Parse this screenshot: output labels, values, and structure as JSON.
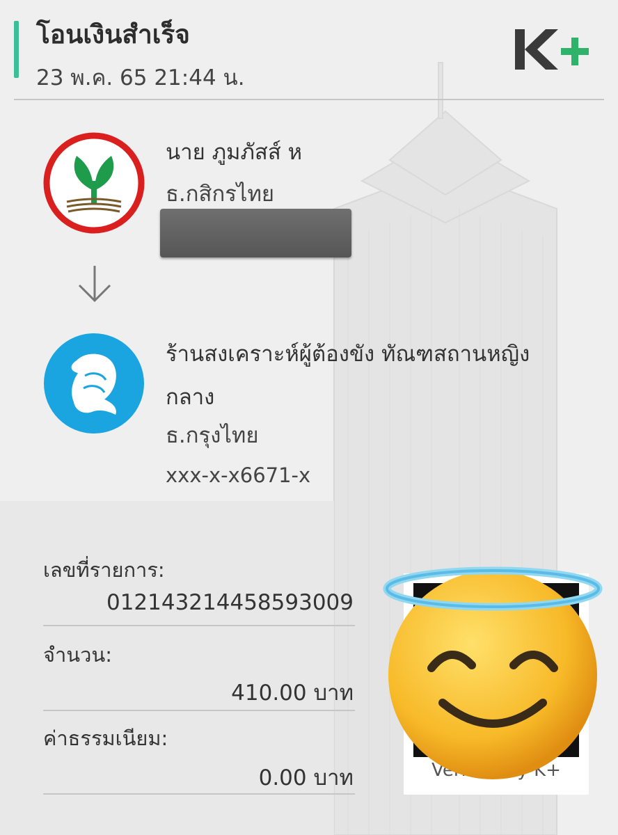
{
  "header": {
    "title": "โอนเงินสำเร็จ",
    "datetime": "23 พ.ค. 65  21:44 น.",
    "logo_icon": "kplus-logo",
    "accent_color": "#3cbf98"
  },
  "sender": {
    "name": "นาย ภูมภัสส์ ห",
    "bank": "ธ.กสิกรไทย",
    "bank_icon": "kasikorn-bank-logo"
  },
  "receiver": {
    "name": "ร้านสงเคราะห์ผู้ต้องขัง ทัณฑสถานหญิงกลาง",
    "bank": "ธ.กรุงไทย",
    "account": "xxx-x-x6671-x",
    "bank_icon": "krungthai-bank-logo"
  },
  "details": {
    "ref_label": "เลขที่รายการ:",
    "ref_value": "012143214458593009",
    "amount_label": "จำนวน:",
    "amount_value": "410.00 บาท",
    "fee_label": "ค่าธรรมเนียม:",
    "fee_value": "0.00 บาท"
  },
  "qr": {
    "verified_text": "Verified by K+"
  },
  "overlay": {
    "icon": "smiling-face-with-halo-emoji"
  }
}
